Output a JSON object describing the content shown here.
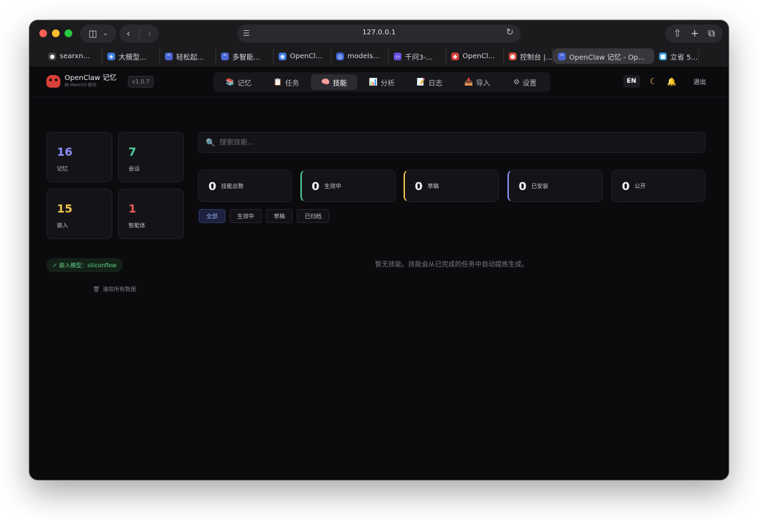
{
  "browser": {
    "url": "127.0.0.1",
    "tabs": [
      {
        "label": "searxn...",
        "icon": "github-icon",
        "color": "#444444"
      },
      {
        "label": "大模型...",
        "icon": "layers-icon",
        "color": "#3b7bdc"
      },
      {
        "label": "轻松起...",
        "icon": "wave-icon",
        "color": "#4a67d6"
      },
      {
        "label": "多智能...",
        "icon": "wave-icon",
        "color": "#4a67d6"
      },
      {
        "label": "OpenCl...",
        "icon": "openclaw-icon",
        "color": "#3d7be0"
      },
      {
        "label": "models...",
        "icon": "robot-icon",
        "color": "#3d63d8"
      },
      {
        "label": "千问3-...",
        "icon": "code-icon",
        "color": "#6a4fe0"
      },
      {
        "label": "OpenCl...",
        "icon": "openclaw-red-icon",
        "color": "#d6403a"
      },
      {
        "label": "控制台 |...",
        "icon": "pin-icon",
        "color": "#e04a3a"
      },
      {
        "label": "OpenClaw 记忆 - Op...",
        "icon": "wave-icon",
        "color": "#4a67d6",
        "active": true
      },
      {
        "label": "立省 5...",
        "icon": "doc-icon",
        "color": "#3aa0e0"
      }
    ]
  },
  "header": {
    "brand_title": "OpenClaw 记忆",
    "brand_sub": "由 MemOS 驱动",
    "version": "v1.0.7",
    "nav": [
      {
        "label": "记忆",
        "icon": "📚"
      },
      {
        "label": "任务",
        "icon": "📋"
      },
      {
        "label": "技能",
        "icon": "🧠",
        "active": true
      },
      {
        "label": "分析",
        "icon": "📊"
      },
      {
        "label": "日志",
        "icon": "📝"
      },
      {
        "label": "导入",
        "icon": "📥"
      },
      {
        "label": "设置",
        "icon": "⚙"
      }
    ],
    "lang": "EN",
    "logout": "退出"
  },
  "sidebar": {
    "stats": [
      {
        "value": "16",
        "label": "记忆",
        "color": "#8b8ff5"
      },
      {
        "value": "7",
        "label": "会话",
        "color": "#4dd0a0"
      },
      {
        "value": "15",
        "label": "嵌入",
        "color": "#f0c24d"
      },
      {
        "value": "1",
        "label": "智能体",
        "color": "#e85a55"
      }
    ],
    "embed_model": "✓ 嵌入模型：siliconflow",
    "clear_all": "清除所有数据"
  },
  "main": {
    "search_placeholder": "搜索技能...",
    "metrics": [
      {
        "value": "0",
        "label": "技能总数",
        "accent": ""
      },
      {
        "value": "0",
        "label": "生效中",
        "accent": "#4dd0a0"
      },
      {
        "value": "0",
        "label": "草稿",
        "accent": "#f0c24d"
      },
      {
        "value": "0",
        "label": "已安装",
        "accent": "#8b8ff5"
      },
      {
        "value": "0",
        "label": "公开",
        "accent": ""
      }
    ],
    "filters": [
      {
        "label": "全部",
        "active": true
      },
      {
        "label": "生效中"
      },
      {
        "label": "草稿"
      },
      {
        "label": "已归档"
      }
    ],
    "empty_text": "暂无技能。技能会从已完成的任务中自动提炼生成。"
  }
}
